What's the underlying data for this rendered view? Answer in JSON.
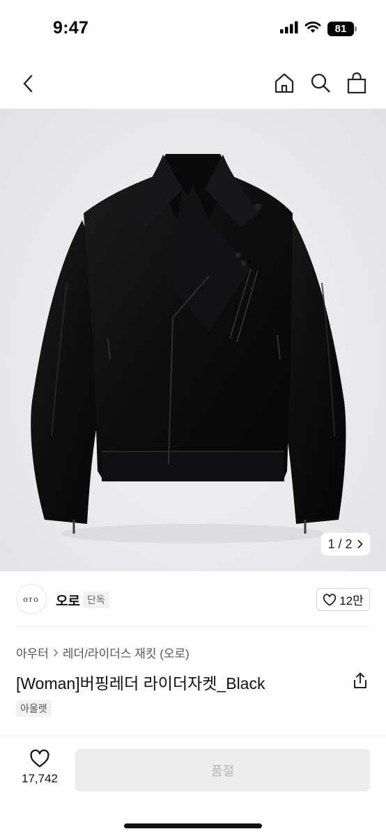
{
  "status": {
    "time": "9:47",
    "battery": "81"
  },
  "nav": {
    "back_icon": "chevron-left-icon",
    "icons": [
      "home-icon",
      "search-icon",
      "shopping-bag-icon"
    ]
  },
  "image": {
    "counter_current": "1",
    "counter_total": "2",
    "counter_sep": "/"
  },
  "brand": {
    "logo_text": "oro",
    "name": "오로",
    "badge": "단독",
    "likes": "12만"
  },
  "breadcrumb": {
    "level1": "아우터",
    "level2": "레더/라이더스 재킷 (오로)"
  },
  "product": {
    "title": "[Woman]버핑레더 라이더자켓_Black",
    "tag": "아울렛"
  },
  "bottom": {
    "wish_count": "17,742",
    "soldout_label": "품절"
  },
  "colors": {
    "accent": "#111111",
    "disabled_bg": "#ececec",
    "disabled_text": "#b5b5b5"
  }
}
